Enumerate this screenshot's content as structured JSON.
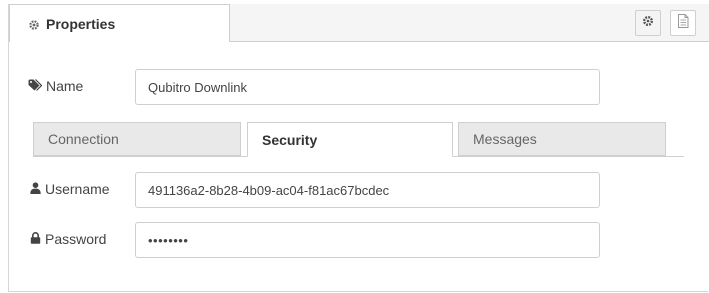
{
  "header": {
    "tab_label": "Properties",
    "icons": [
      "cog-icon",
      "gear-icon",
      "document-icon"
    ]
  },
  "name_row": {
    "label": "Name",
    "value": "Qubitro Downlink",
    "icon": "tag-icon"
  },
  "tabs": [
    {
      "label": "Connection",
      "active": false
    },
    {
      "label": "Security",
      "active": true
    },
    {
      "label": "Messages",
      "active": false
    }
  ],
  "username_row": {
    "label": "Username",
    "value": "491136a2-8b28-4b09-ac04-f81ac67bcdec",
    "icon": "user-icon"
  },
  "password_row": {
    "label": "Password",
    "value": "••••••••",
    "icon": "lock-icon"
  },
  "colors": {
    "border": "#cfcfcf",
    "inactive_tab_bg": "#e9e9e9",
    "text": "#444444"
  }
}
